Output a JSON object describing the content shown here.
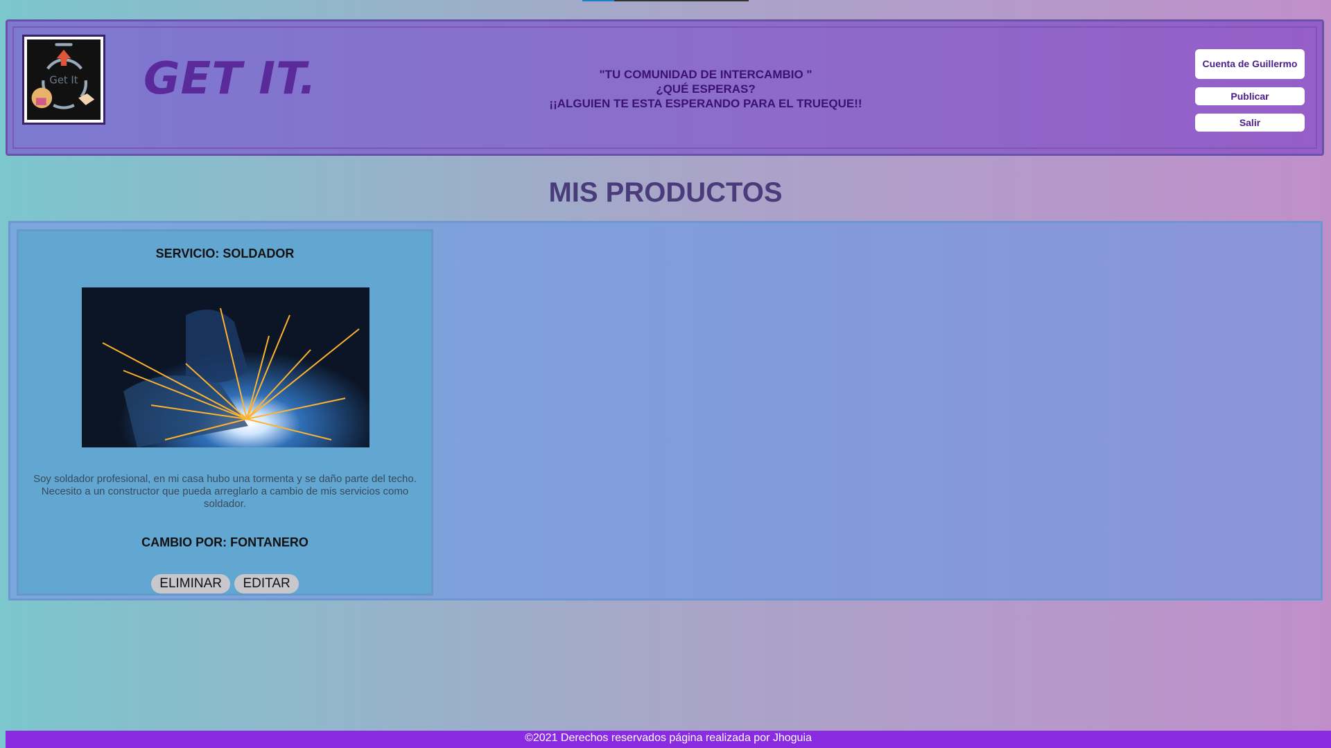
{
  "header": {
    "logo_alt": "Get It",
    "brand": "GET IT.",
    "tagline": [
      "\"TU COMUNIDAD DE INTERCAMBIO \"",
      "¿QUÉ ESPERAS?",
      "¡¡ALGUIEN TE ESTA ESPERANDO PARA EL TRUEQUE!!"
    ],
    "account_label": "Cuenta de Guillermo",
    "publish_label": "Publicar",
    "logout_label": "Salir"
  },
  "main": {
    "title": "MIS PRODUCTOS",
    "products": [
      {
        "service": "SERVICIO: SOLDADOR",
        "image": "welder-sparks-photo",
        "description": "Soy soldador profesional, en mi casa hubo una tormenta y se daño parte del techo. Necesito a un constructor que pueda arreglarlo a cambio de mis servicios como soldador.",
        "exchange": "CAMBIO POR: FONTANERO",
        "delete_label": "ELIMINAR",
        "edit_label": "EDITAR"
      }
    ]
  },
  "footer": {
    "text": "©2021 Derechos reservados página realizada por Jhoguia"
  },
  "colors": {
    "header_bg": "#8b6dcc",
    "brand": "#5a2a9a",
    "footer_bg": "#8a2be2",
    "card_bg": "#62a6d2"
  }
}
